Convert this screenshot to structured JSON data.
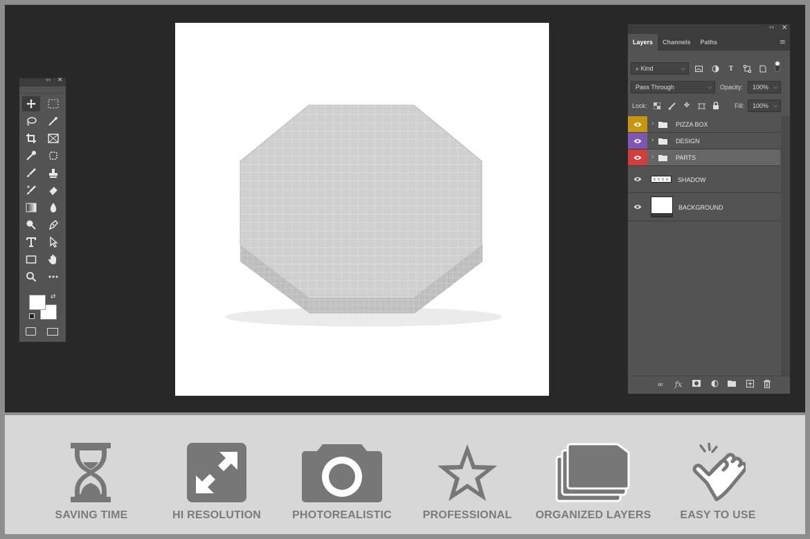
{
  "layers_panel": {
    "tabs": [
      "Layers",
      "Channels",
      "Paths"
    ],
    "filter_kind": "Kind",
    "blend_mode": "Pass Through",
    "opacity_label": "Opacity:",
    "opacity_value": "100%",
    "lock_label": "Lock:",
    "fill_label": "Fill:",
    "fill_value": "100%",
    "layers": [
      {
        "name": "PIZZA BOX",
        "type": "group",
        "color": "#c8960e"
      },
      {
        "name": "DESIGN",
        "type": "group",
        "color": "#7e57b3"
      },
      {
        "name": "PARTS",
        "type": "group",
        "color": "#d23d3d"
      },
      {
        "name": "SHADOW",
        "type": "layer",
        "color": ""
      },
      {
        "name": "BACKGROUND",
        "type": "layer",
        "color": ""
      }
    ]
  },
  "tool_icons": [
    "move-tool-icon",
    "marquee-tool-icon",
    "lasso-tool-icon",
    "magic-wand-icon",
    "crop-tool-icon",
    "frame-tool-icon",
    "eyedropper-icon",
    "healing-icon",
    "brush-icon",
    "stamp-icon",
    "history-brush-icon",
    "eraser-icon",
    "gradient-icon",
    "blur-icon",
    "dodge-icon",
    "pen-icon",
    "type-tool-icon",
    "path-select-icon",
    "rectangle-tool-icon",
    "hand-tool-icon",
    "zoom-tool-icon",
    "more-tools-icon"
  ],
  "features": [
    {
      "label": "SAVING TIME",
      "icon": "hourglass-icon"
    },
    {
      "label": "HI RESOLUTION",
      "icon": "expand-arrows-icon"
    },
    {
      "label": "PHOTOREALISTIC",
      "icon": "camera-icon"
    },
    {
      "label": "PROFESSIONAL",
      "icon": "star-icon"
    },
    {
      "label": "ORGANIZED LAYERS",
      "icon": "stacked-folders-icon"
    },
    {
      "label": "EASY TO USE",
      "icon": "tap-hand-icon"
    }
  ],
  "colors": {
    "workspace": "#282828",
    "panel": "#535353",
    "band": "#d7d7d7",
    "feature_text": "#7b7b7b"
  }
}
